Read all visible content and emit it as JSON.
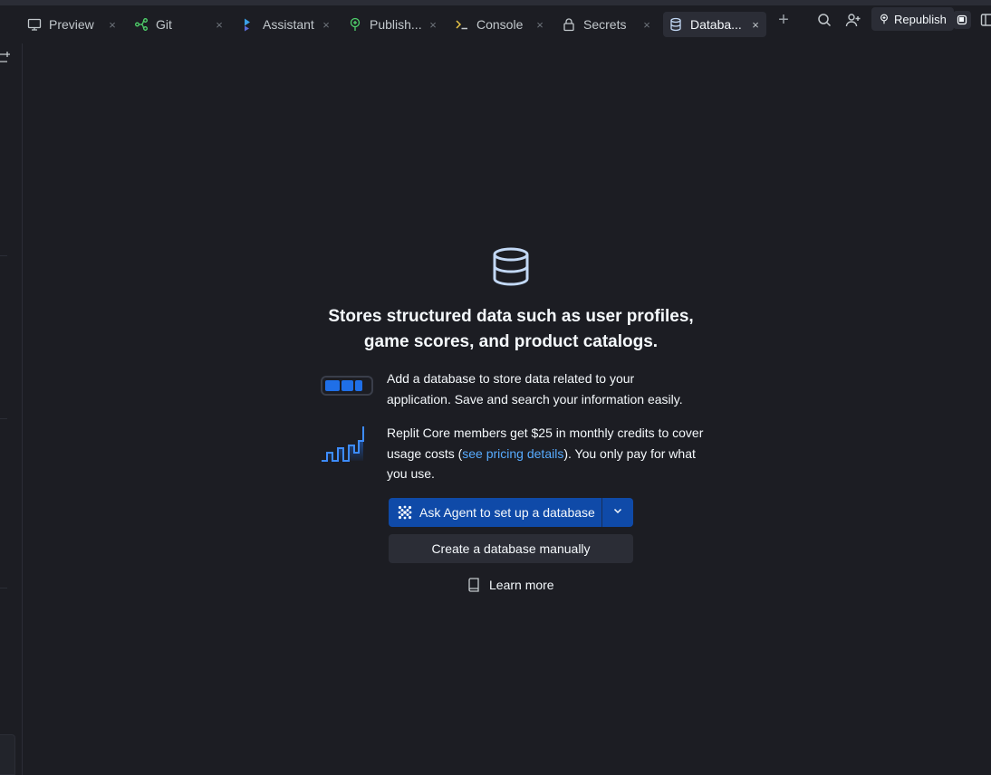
{
  "tabs": [
    {
      "label": "Preview",
      "icon": "monitor-icon",
      "active": false
    },
    {
      "label": "Git",
      "icon": "git-branch-icon",
      "active": false
    },
    {
      "label": "Assistant",
      "icon": "assistant-icon",
      "active": false
    },
    {
      "label": "Publish...",
      "icon": "publish-icon",
      "active": false
    },
    {
      "label": "Console",
      "icon": "terminal-icon",
      "active": false
    },
    {
      "label": "Secrets",
      "icon": "lock-icon",
      "active": false
    },
    {
      "label": "Databa...",
      "icon": "database-icon",
      "active": true
    }
  ],
  "header": {
    "republish_label": "Republish"
  },
  "empty_state": {
    "headline_line1": "Stores structured data such as user profiles,",
    "headline_line2": "game scores, and product catalogs.",
    "feature1_text": "Add a database to store data related to your application. Save and search your information easily.",
    "feature2_text_before": "Replit Core members get $25 in monthly credits to cover usage costs (",
    "feature2_link": "see pricing details",
    "feature2_text_after": "). You only pay for what you use.",
    "agent_button_label": "Ask Agent to set up a database",
    "manual_button_label": "Create a database manually",
    "learn_more_label": "Learn more"
  },
  "colors": {
    "background": "#1c1d23",
    "surface": "#2b2d36",
    "accent": "#0f4aa8",
    "link": "#57abff",
    "text": "#f5f9fc"
  }
}
